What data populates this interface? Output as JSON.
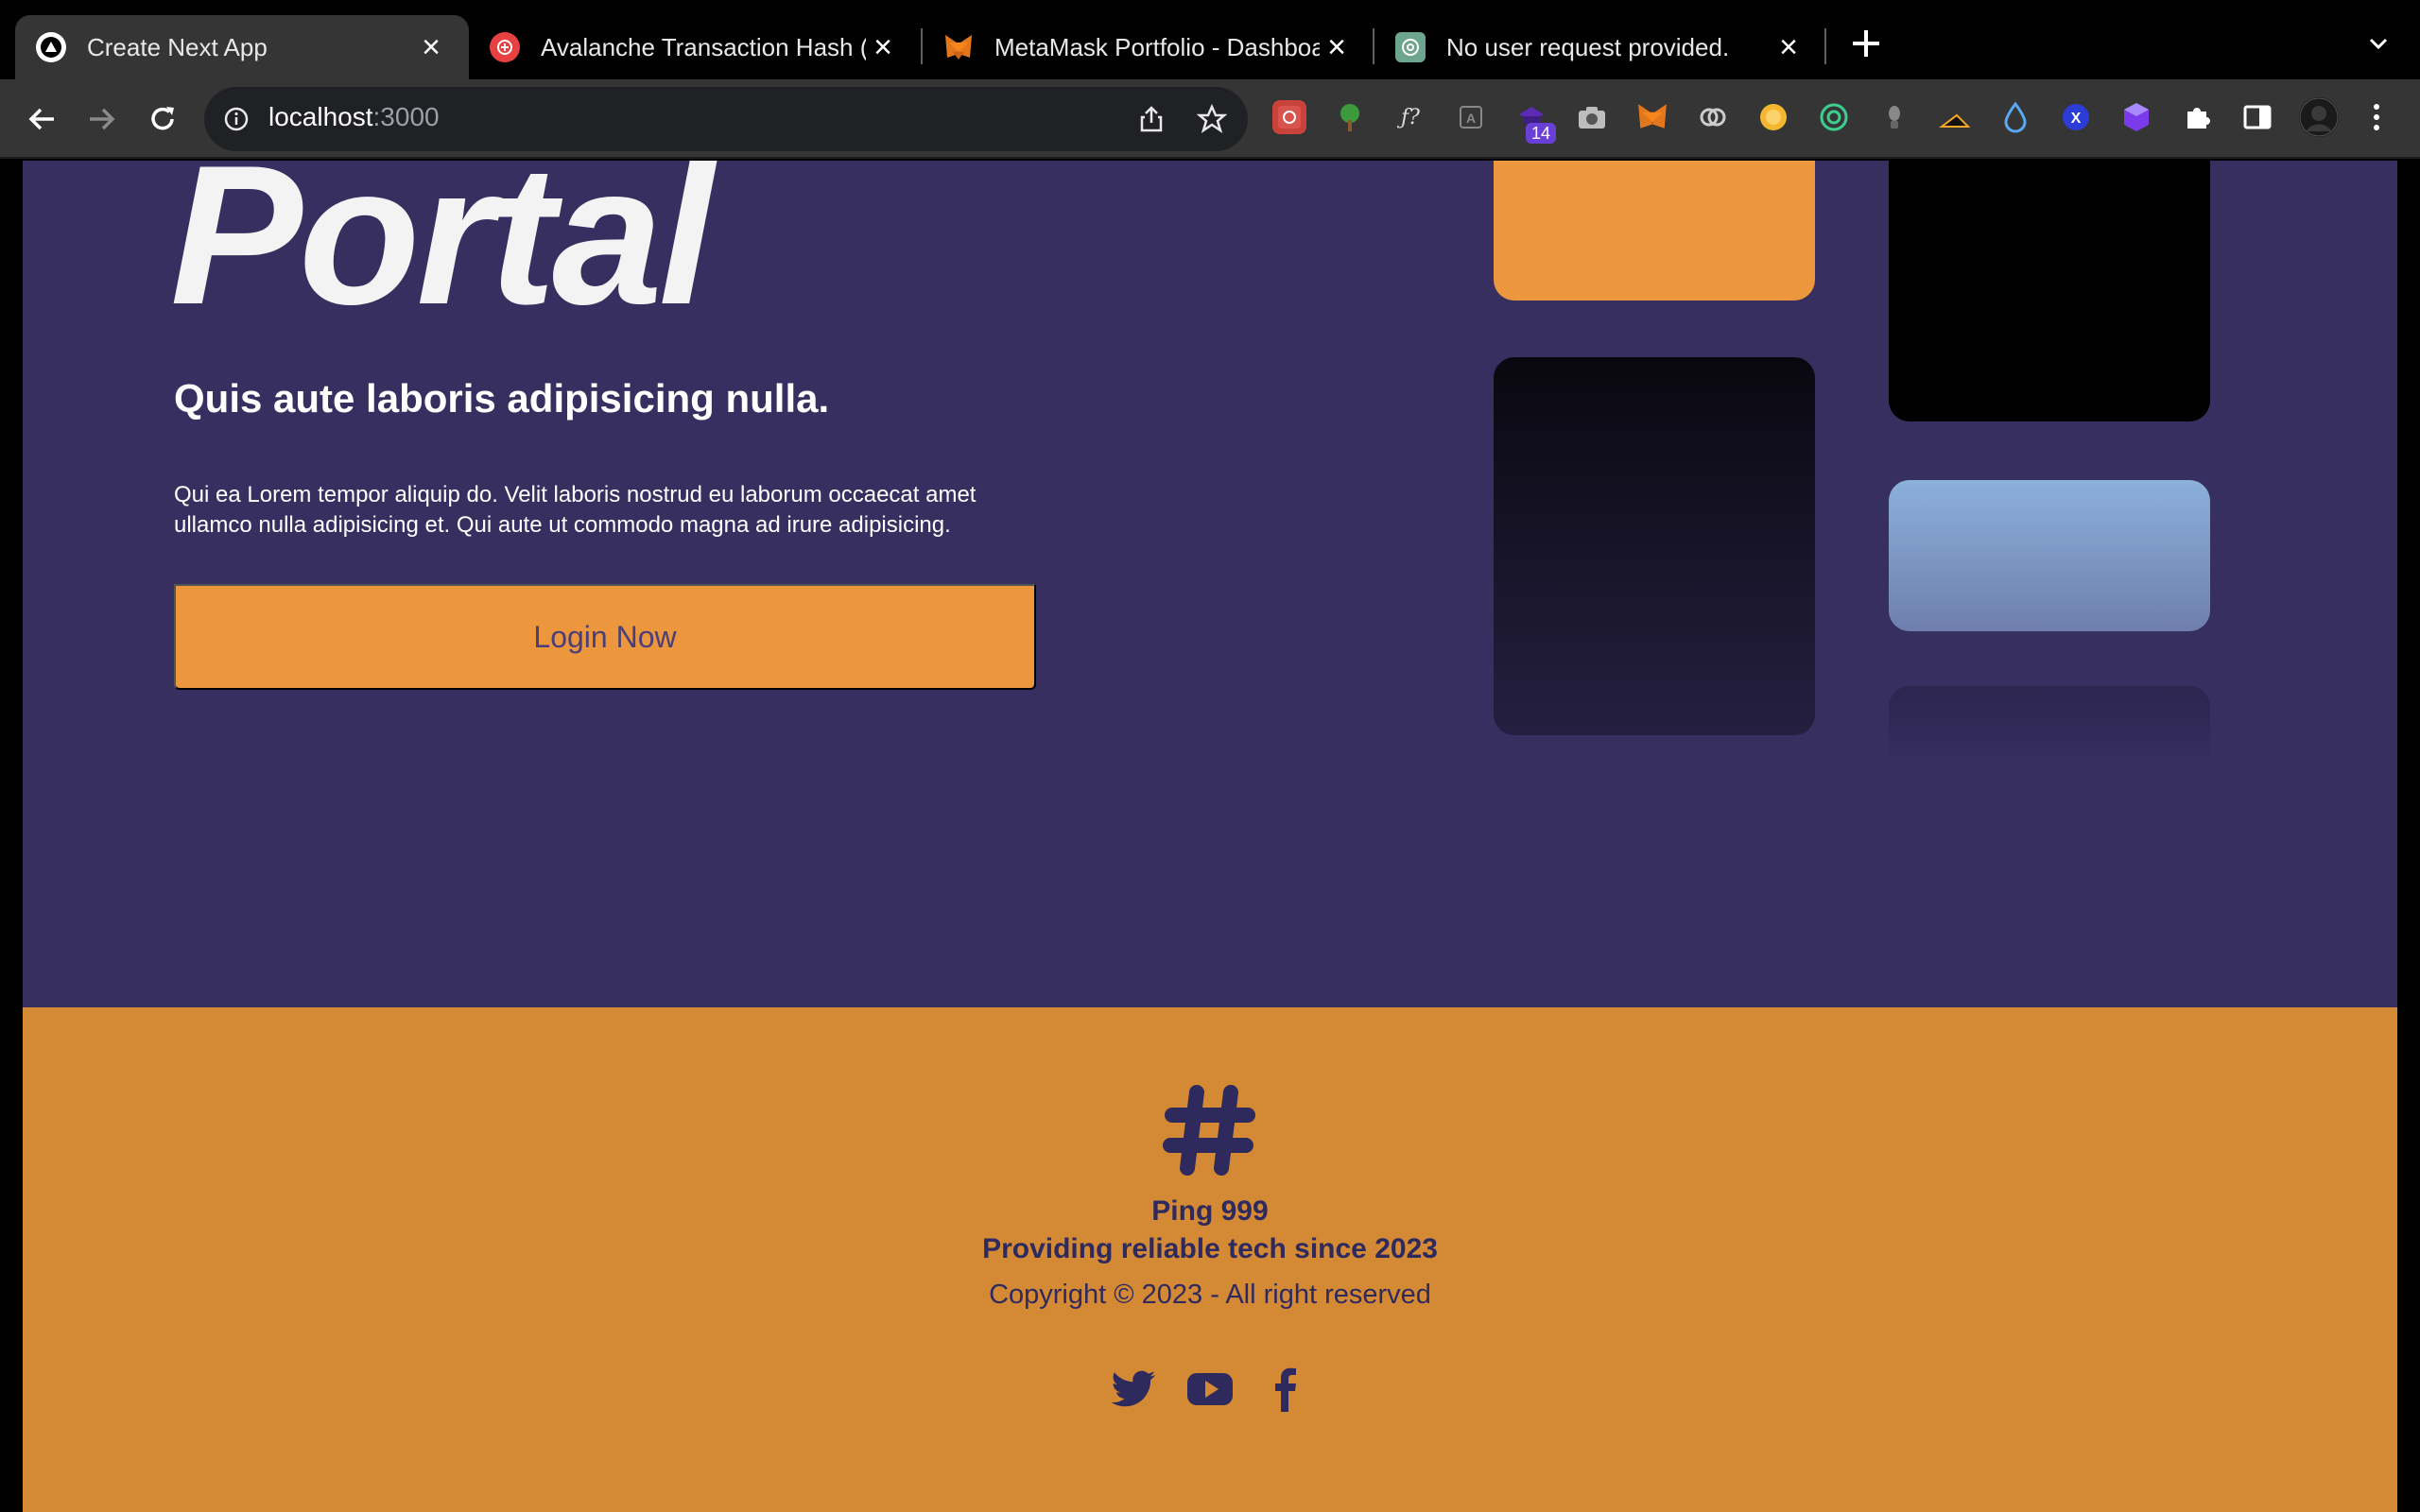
{
  "browser": {
    "tabs": [
      {
        "title": "Create Next App",
        "active": true,
        "icon": "next-icon"
      },
      {
        "title": "Avalanche Transaction Hash (T",
        "active": false,
        "icon": "avalanche-icon"
      },
      {
        "title": "MetaMask Portfolio - Dashboa",
        "active": false,
        "icon": "metamask-fox-icon"
      },
      {
        "title": "No user request provided.",
        "active": false,
        "icon": "openai-icon"
      }
    ],
    "address_bar": {
      "host": "localhost",
      "port": ":3000"
    },
    "extensions": [
      "ext-icon-1",
      "ext-icon-2",
      "ext-icon-3",
      "ext-icon-4",
      "ext-icon-5",
      "camera-icon",
      "metamask-icon",
      "link-icon",
      "coin-icon",
      "ring-icon",
      "ext-icon-11",
      "ext-icon-12",
      "drop-icon",
      "x-icon",
      "cube-icon",
      "puzzle-icon",
      "sidepanel-icon",
      "avatar",
      "menu-icon"
    ],
    "extension_badge": "14",
    "x_ext_label": "X",
    "colors": {
      "tab_bg": "#000000",
      "toolbar_bg": "#353535",
      "omnibox_bg": "#202124"
    }
  },
  "hero": {
    "title": "Portal",
    "subtitle": "Quis aute laboris adipisicing nulla.",
    "description": "Qui ea Lorem tempor aliquip do. Velit laboris nostrud eu laborum occaecat amet ullamco nulla adipisicing et. Qui aute ut commodo magna ad irure adipisicing.",
    "cta_label": "Login Now",
    "colors": {
      "background": "#372f60",
      "accent": "#ec963e",
      "text": "#ffffff"
    }
  },
  "footer": {
    "brand_name": "Ping 999",
    "tagline": "Providing reliable tech since 2023",
    "copyright": "Copyright © 2023 - All right reserved",
    "social": [
      "twitter-icon",
      "youtube-icon",
      "facebook-icon"
    ],
    "colors": {
      "background": "#d48935",
      "text": "#2f2a5e"
    }
  }
}
